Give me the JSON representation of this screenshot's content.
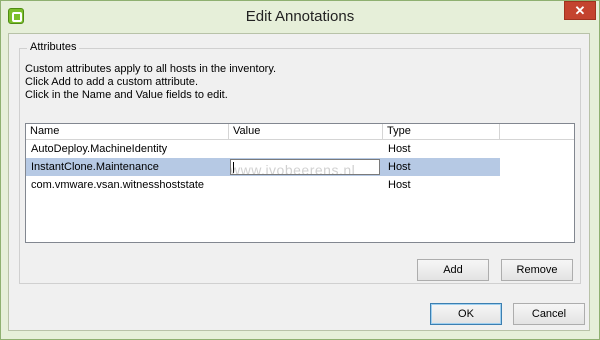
{
  "window": {
    "title": "Edit Annotations",
    "close_label": "✕"
  },
  "attributes": {
    "legend": "Attributes",
    "help_lines": [
      "Custom attributes apply to all hosts in the inventory.",
      "Click Add to add a custom attribute.",
      "Click in the Name and Value fields to edit."
    ]
  },
  "table": {
    "columns": [
      "Name",
      "Value",
      "Type"
    ],
    "rows": [
      {
        "name": "AutoDeploy.MachineIdentity",
        "value": "",
        "type": "Host"
      },
      {
        "name": "InstantClone.Maintenance",
        "value": "",
        "type": "Host"
      },
      {
        "name": "com.vmware.vsan.witnesshoststate",
        "value": "",
        "type": "Host"
      }
    ]
  },
  "watermark": "www.ivobeerens.nl",
  "buttons": {
    "add": "Add",
    "remove": "Remove",
    "ok": "OK",
    "cancel": "Cancel"
  }
}
